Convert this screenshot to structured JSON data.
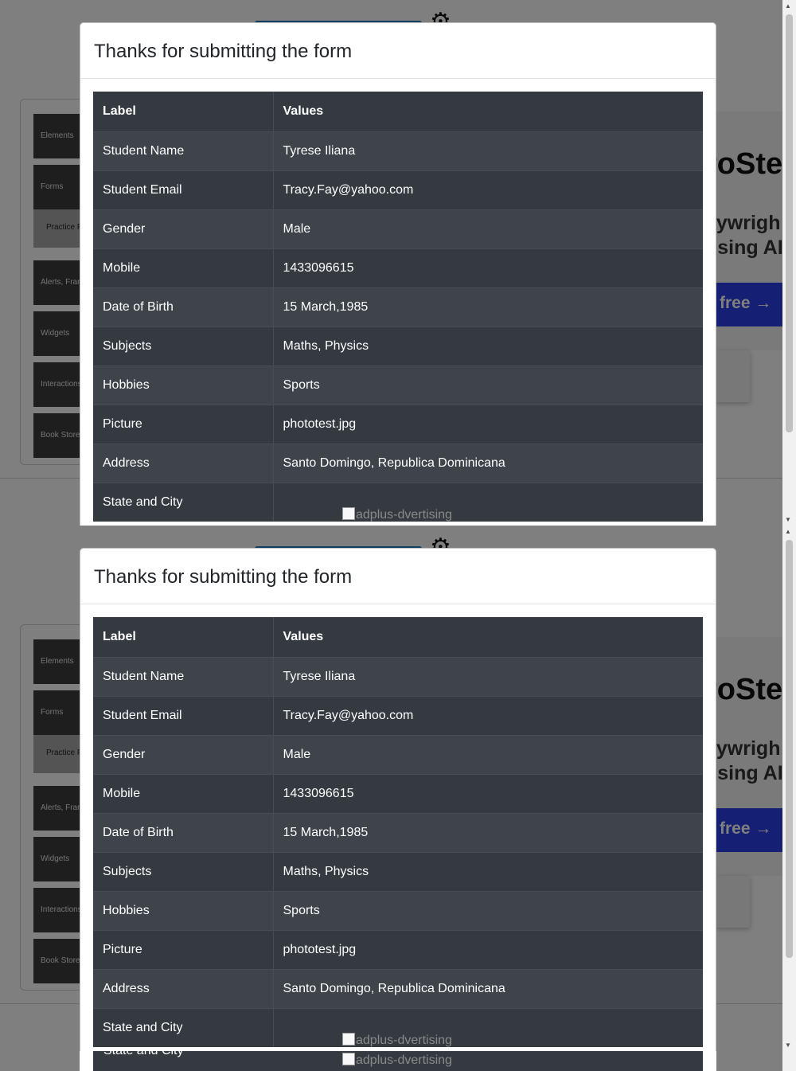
{
  "modal": {
    "title": "Thanks for submitting the form",
    "columns": [
      "Label",
      "Values"
    ],
    "rows": [
      {
        "label": "Student Name",
        "value": "Tyrese Iliana"
      },
      {
        "label": "Student Email",
        "value": "Tracy.Fay@yahoo.com"
      },
      {
        "label": "Gender",
        "value": "Male"
      },
      {
        "label": "Mobile",
        "value": "1433096615"
      },
      {
        "label": "Date of Birth",
        "value": "15 March,1985"
      },
      {
        "label": "Subjects",
        "value": "Maths, Physics"
      },
      {
        "label": "Hobbies",
        "value": "Sports"
      },
      {
        "label": "Picture",
        "value": "phototest.jpg"
      },
      {
        "label": "Address",
        "value": "Santo Domingo, Republica Dominicana"
      },
      {
        "label": "State and City",
        "value": ""
      }
    ]
  },
  "ad_image_alt": "adplus-dvertising",
  "background": {
    "menu": [
      "Elements",
      "Forms",
      "Practice Form",
      "Alerts, Frame & Windows",
      "Widgets",
      "Interactions",
      "Book Store Application"
    ],
    "ad": {
      "line1": "roSte",
      "line2": "aywrigh",
      "line3": "using AI",
      "button": "free →"
    }
  },
  "colors": {
    "table_dark": "#343a40",
    "table_stripe": "#3e444a",
    "ad_button": "#2a3fe6"
  }
}
